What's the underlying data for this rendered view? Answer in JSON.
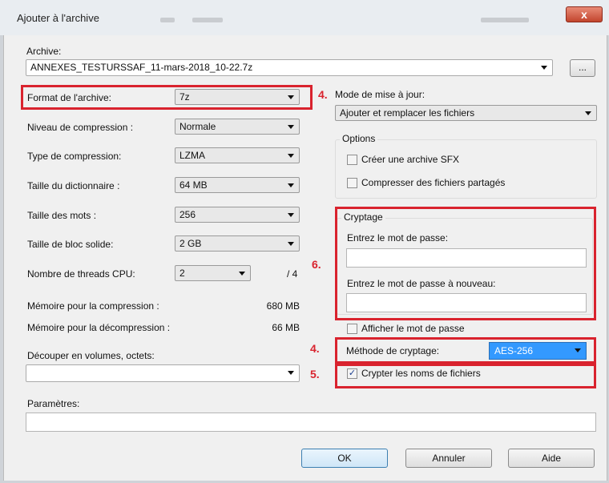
{
  "window": {
    "title": "Ajouter à l'archive",
    "close_label": "x"
  },
  "archive": {
    "label": "Archive:",
    "path": "ANNEXES_TESTURSSAF_11-mars-2018_10-22.7z",
    "browse_label": "..."
  },
  "left": {
    "format": {
      "label": "Format de l'archive:",
      "value": "7z"
    },
    "level": {
      "label": "Niveau de compression :",
      "value": "Normale"
    },
    "type": {
      "label": "Type de compression:",
      "value": "LZMA"
    },
    "dict": {
      "label": "Taille du dictionnaire :",
      "value": "64 MB"
    },
    "words": {
      "label": "Taille des mots :",
      "value": "256"
    },
    "block": {
      "label": "Taille de bloc solide:",
      "value": "2 GB"
    },
    "threads": {
      "label": "Nombre de threads CPU:",
      "value": "2",
      "max": "/ 4"
    },
    "mem_comp": {
      "label": "Mémoire pour la compression :",
      "value": "680 MB"
    },
    "mem_decomp": {
      "label": "Mémoire pour la décompression :",
      "value": "66 MB"
    },
    "split": {
      "label": "Découper en volumes, octets:",
      "value": ""
    },
    "params": {
      "label": "Paramètres:",
      "value": ""
    }
  },
  "right": {
    "update_mode": {
      "label": "Mode de mise à jour:",
      "value": "Ajouter et remplacer les fichiers"
    },
    "options": {
      "title": "Options",
      "sfx": "Créer une archive SFX",
      "shared": "Compresser des fichiers partagés"
    },
    "crypto": {
      "title": "Cryptage",
      "password_label": "Entrez le mot de passe:",
      "password_again_label": "Entrez le mot de passe à nouveau:",
      "show_password": "Afficher le mot de passe",
      "method_label": "Méthode de cryptage:",
      "method_value": "AES-256",
      "encrypt_names": "Crypter les noms de fichiers",
      "encrypt_names_checked": true
    }
  },
  "buttons": {
    "ok": "OK",
    "cancel": "Annuler",
    "help": "Aide"
  },
  "annotations": {
    "a1": "4.",
    "a2": "6.",
    "a3": "4.",
    "a4": "5."
  },
  "colors": {
    "annotation_red": "#d9232e",
    "selection_blue": "#3399ff"
  }
}
